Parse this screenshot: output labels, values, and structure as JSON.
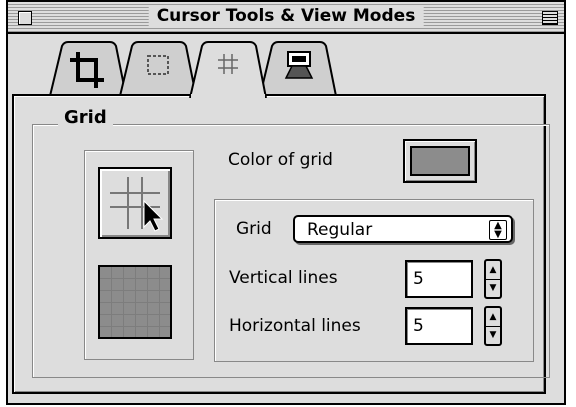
{
  "window": {
    "title": "Cursor Tools & View Modes"
  },
  "tabs": [
    {
      "icon": "crop-icon",
      "selected": false
    },
    {
      "icon": "selection-marquee-icon",
      "selected": false
    },
    {
      "icon": "grid-icon",
      "selected": true
    },
    {
      "icon": "view-mode-icon",
      "selected": false
    }
  ],
  "grid_group": {
    "title": "Grid",
    "color_label": "Color of grid",
    "grid_color": "#8c8c8c",
    "grid_type_label": "Grid",
    "grid_type_value": "Regular",
    "vertical_label": "Vertical lines",
    "vertical_value": "5",
    "horizontal_label": "Horizontal lines",
    "horizontal_value": "5"
  },
  "colors": {
    "window_bg": "#dddddd",
    "swatch": "#8c8c8c"
  }
}
